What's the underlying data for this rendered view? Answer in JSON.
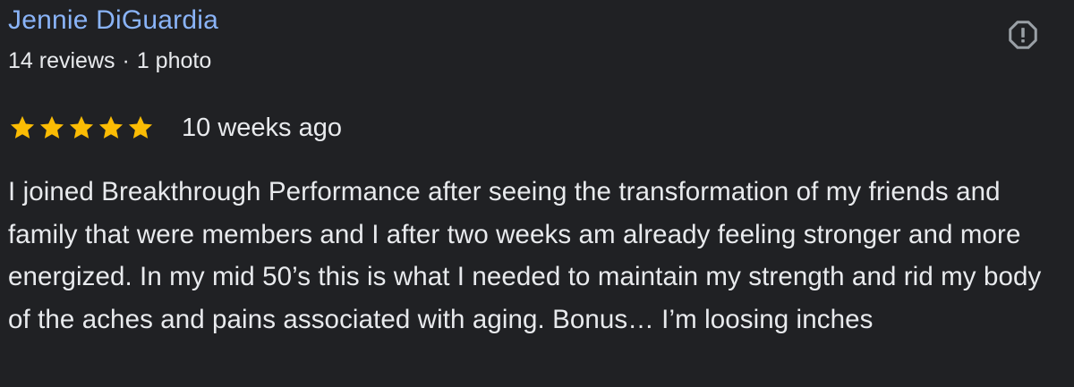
{
  "review": {
    "author_name": "Jennie DiGuardia",
    "review_count": "14 reviews",
    "separator": "·",
    "photo_count": "1 photo",
    "rating": 5,
    "rating_max": 5,
    "time_ago": "10 weeks ago",
    "text": "I joined Breakthrough Performance after seeing the transformation of my friends and family that were members and I after two weeks am already feeling stronger and more energized. In my mid 50’s this is what I needed to maintain my strength and rid my body of the aches and pains associated with aging. Bonus… I’m loosing inches"
  },
  "icons": {
    "report": "report-icon",
    "star": "star-icon"
  },
  "colors": {
    "background": "#202124",
    "author_link": "#8ab4f8",
    "text": "#e8eaed",
    "star": "#fbbc04",
    "icon": "#9aa0a6"
  }
}
